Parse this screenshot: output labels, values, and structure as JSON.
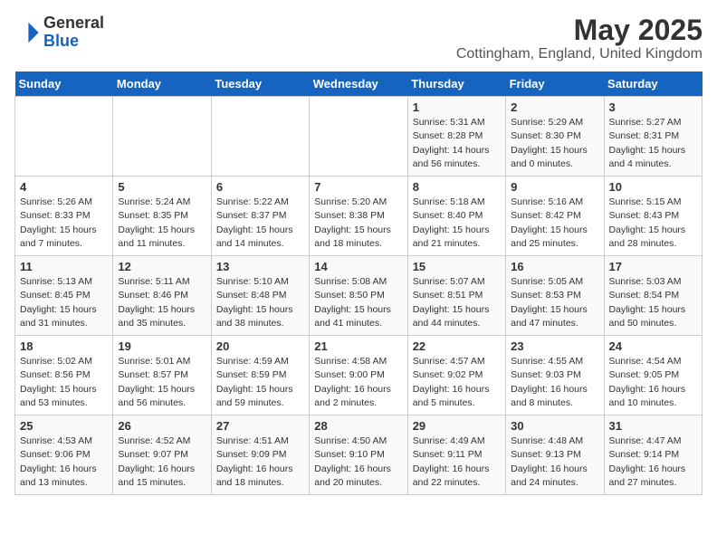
{
  "header": {
    "logo_general": "General",
    "logo_blue": "Blue",
    "month": "May 2025",
    "location": "Cottingham, England, United Kingdom"
  },
  "weekdays": [
    "Sunday",
    "Monday",
    "Tuesday",
    "Wednesday",
    "Thursday",
    "Friday",
    "Saturday"
  ],
  "weeks": [
    [
      {
        "day": "",
        "info": ""
      },
      {
        "day": "",
        "info": ""
      },
      {
        "day": "",
        "info": ""
      },
      {
        "day": "",
        "info": ""
      },
      {
        "day": "1",
        "info": "Sunrise: 5:31 AM\nSunset: 8:28 PM\nDaylight: 14 hours\nand 56 minutes."
      },
      {
        "day": "2",
        "info": "Sunrise: 5:29 AM\nSunset: 8:30 PM\nDaylight: 15 hours\nand 0 minutes."
      },
      {
        "day": "3",
        "info": "Sunrise: 5:27 AM\nSunset: 8:31 PM\nDaylight: 15 hours\nand 4 minutes."
      }
    ],
    [
      {
        "day": "4",
        "info": "Sunrise: 5:26 AM\nSunset: 8:33 PM\nDaylight: 15 hours\nand 7 minutes."
      },
      {
        "day": "5",
        "info": "Sunrise: 5:24 AM\nSunset: 8:35 PM\nDaylight: 15 hours\nand 11 minutes."
      },
      {
        "day": "6",
        "info": "Sunrise: 5:22 AM\nSunset: 8:37 PM\nDaylight: 15 hours\nand 14 minutes."
      },
      {
        "day": "7",
        "info": "Sunrise: 5:20 AM\nSunset: 8:38 PM\nDaylight: 15 hours\nand 18 minutes."
      },
      {
        "day": "8",
        "info": "Sunrise: 5:18 AM\nSunset: 8:40 PM\nDaylight: 15 hours\nand 21 minutes."
      },
      {
        "day": "9",
        "info": "Sunrise: 5:16 AM\nSunset: 8:42 PM\nDaylight: 15 hours\nand 25 minutes."
      },
      {
        "day": "10",
        "info": "Sunrise: 5:15 AM\nSunset: 8:43 PM\nDaylight: 15 hours\nand 28 minutes."
      }
    ],
    [
      {
        "day": "11",
        "info": "Sunrise: 5:13 AM\nSunset: 8:45 PM\nDaylight: 15 hours\nand 31 minutes."
      },
      {
        "day": "12",
        "info": "Sunrise: 5:11 AM\nSunset: 8:46 PM\nDaylight: 15 hours\nand 35 minutes."
      },
      {
        "day": "13",
        "info": "Sunrise: 5:10 AM\nSunset: 8:48 PM\nDaylight: 15 hours\nand 38 minutes."
      },
      {
        "day": "14",
        "info": "Sunrise: 5:08 AM\nSunset: 8:50 PM\nDaylight: 15 hours\nand 41 minutes."
      },
      {
        "day": "15",
        "info": "Sunrise: 5:07 AM\nSunset: 8:51 PM\nDaylight: 15 hours\nand 44 minutes."
      },
      {
        "day": "16",
        "info": "Sunrise: 5:05 AM\nSunset: 8:53 PM\nDaylight: 15 hours\nand 47 minutes."
      },
      {
        "day": "17",
        "info": "Sunrise: 5:03 AM\nSunset: 8:54 PM\nDaylight: 15 hours\nand 50 minutes."
      }
    ],
    [
      {
        "day": "18",
        "info": "Sunrise: 5:02 AM\nSunset: 8:56 PM\nDaylight: 15 hours\nand 53 minutes."
      },
      {
        "day": "19",
        "info": "Sunrise: 5:01 AM\nSunset: 8:57 PM\nDaylight: 15 hours\nand 56 minutes."
      },
      {
        "day": "20",
        "info": "Sunrise: 4:59 AM\nSunset: 8:59 PM\nDaylight: 15 hours\nand 59 minutes."
      },
      {
        "day": "21",
        "info": "Sunrise: 4:58 AM\nSunset: 9:00 PM\nDaylight: 16 hours\nand 2 minutes."
      },
      {
        "day": "22",
        "info": "Sunrise: 4:57 AM\nSunset: 9:02 PM\nDaylight: 16 hours\nand 5 minutes."
      },
      {
        "day": "23",
        "info": "Sunrise: 4:55 AM\nSunset: 9:03 PM\nDaylight: 16 hours\nand 8 minutes."
      },
      {
        "day": "24",
        "info": "Sunrise: 4:54 AM\nSunset: 9:05 PM\nDaylight: 16 hours\nand 10 minutes."
      }
    ],
    [
      {
        "day": "25",
        "info": "Sunrise: 4:53 AM\nSunset: 9:06 PM\nDaylight: 16 hours\nand 13 minutes."
      },
      {
        "day": "26",
        "info": "Sunrise: 4:52 AM\nSunset: 9:07 PM\nDaylight: 16 hours\nand 15 minutes."
      },
      {
        "day": "27",
        "info": "Sunrise: 4:51 AM\nSunset: 9:09 PM\nDaylight: 16 hours\nand 18 minutes."
      },
      {
        "day": "28",
        "info": "Sunrise: 4:50 AM\nSunset: 9:10 PM\nDaylight: 16 hours\nand 20 minutes."
      },
      {
        "day": "29",
        "info": "Sunrise: 4:49 AM\nSunset: 9:11 PM\nDaylight: 16 hours\nand 22 minutes."
      },
      {
        "day": "30",
        "info": "Sunrise: 4:48 AM\nSunset: 9:13 PM\nDaylight: 16 hours\nand 24 minutes."
      },
      {
        "day": "31",
        "info": "Sunrise: 4:47 AM\nSunset: 9:14 PM\nDaylight: 16 hours\nand 27 minutes."
      }
    ]
  ]
}
